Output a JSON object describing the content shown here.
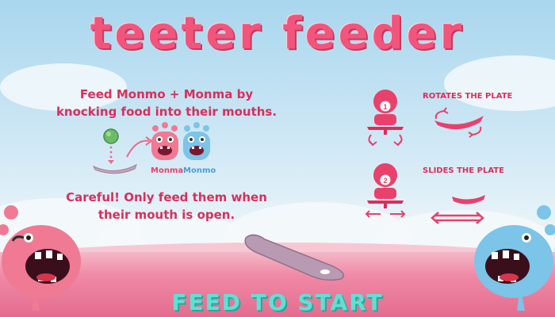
{
  "game_title": "teeter feeder",
  "instructions": {
    "line1": "Feed Monmo + Monma by",
    "line2": "knocking food into their mouths.",
    "warning1": "Careful! Only feed them when",
    "warning2": "their mouth is open."
  },
  "characters": {
    "pink_name": "Monma",
    "blue_name": "Monmo"
  },
  "controls": {
    "rotate_label": "ROTATES THE PLATE",
    "rotate_badge": "1",
    "slide_label": "SLIDES THE PLATE",
    "slide_badge": "2"
  },
  "start_prompt": "FEED TO START",
  "colors": {
    "brand_pink": "#f2557c",
    "text_pink": "#d92e5c",
    "monster_pink": "#f07a93",
    "monster_blue": "#7cc4e8",
    "start_teal": "#5fe0d4",
    "plate_gray": "#c6a5bd",
    "food_green": "#6dbb6a"
  }
}
